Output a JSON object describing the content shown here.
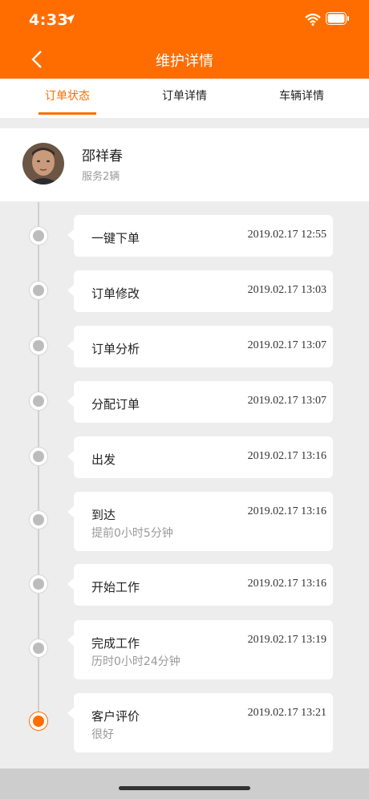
{
  "status_bar": {
    "time": "4:33"
  },
  "header": {
    "title": "维护详情"
  },
  "tabs": [
    {
      "label": "订单状态",
      "active": true
    },
    {
      "label": "订单详情",
      "active": false
    },
    {
      "label": "车辆详情",
      "active": false
    }
  ],
  "profile": {
    "name": "邵祥春",
    "service": "服务2辆"
  },
  "timeline": [
    {
      "title": "一键下单",
      "time": "2019.02.17 12:55",
      "sub": ""
    },
    {
      "title": "订单修改",
      "time": "2019.02.17 13:03",
      "sub": ""
    },
    {
      "title": "订单分析",
      "time": "2019.02.17 13:07",
      "sub": ""
    },
    {
      "title": "分配订单",
      "time": "2019.02.17 13:07",
      "sub": ""
    },
    {
      "title": "出发",
      "time": "2019.02.17 13:16",
      "sub": ""
    },
    {
      "title": "到达",
      "time": "2019.02.17 13:16",
      "sub": "提前0小时5分钟"
    },
    {
      "title": "开始工作",
      "time": "2019.02.17 13:16",
      "sub": ""
    },
    {
      "title": "完成工作",
      "time": "2019.02.17 13:19",
      "sub": "历时0小时24分钟"
    },
    {
      "title": "客户评价",
      "time": "2019.02.17 13:21",
      "sub": "很好"
    }
  ],
  "colors": {
    "accent": "#ff6d00",
    "background": "#ededed"
  }
}
